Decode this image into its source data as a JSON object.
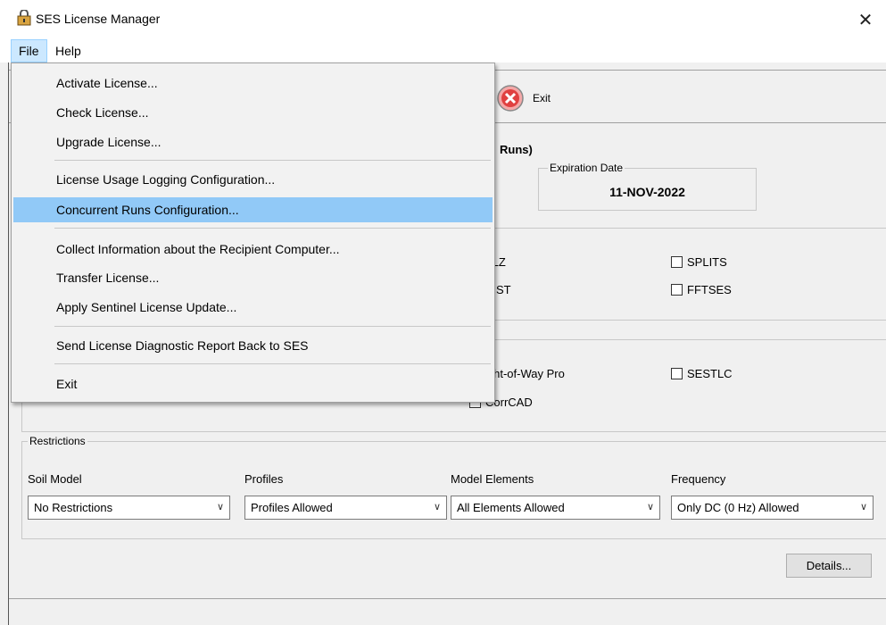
{
  "window": {
    "title": "SES License Manager",
    "close_glyph": "✕"
  },
  "menubar": {
    "file": "File",
    "help": "Help"
  },
  "toolbar": {
    "exit_label": "Exit"
  },
  "license": {
    "section_title_partial": "Runs)",
    "expiration_label": "Expiration Date",
    "expiration_value": "11-NOV-2022"
  },
  "modules_group1": [
    {
      "label": "ALZ",
      "checked": false
    },
    {
      "label": "SPLITS",
      "checked": false
    },
    {
      "label": "DIST",
      "checked": false
    },
    {
      "label": "FFTSES",
      "checked": false
    }
  ],
  "modules_group2": [
    {
      "label": "ight-of-Way Pro",
      "checked": false
    },
    {
      "label": "SESTLC",
      "checked": false
    },
    {
      "label": "CorrCAD",
      "checked": false
    }
  ],
  "restrictions": {
    "legend": "Restrictions",
    "fields": [
      {
        "label": "Soil Model",
        "value": "No Restrictions"
      },
      {
        "label": "Profiles",
        "value": "Profiles Allowed"
      },
      {
        "label": "Model Elements",
        "value": "All Elements Allowed"
      },
      {
        "label": "Frequency",
        "value": "Only DC (0 Hz) Allowed"
      }
    ]
  },
  "details_button": "Details...",
  "file_menu": {
    "items": [
      "Activate License...",
      "Check License...",
      "Upgrade License...",
      "License Usage Logging Configuration...",
      "Concurrent Runs Configuration...",
      "Collect Information about the Recipient Computer...",
      "Transfer License...",
      "Apply Sentinel License Update...",
      "Send License Diagnostic Report Back to SES",
      "Exit"
    ],
    "highlighted": "Concurrent Runs Configuration..."
  },
  "colors": {
    "highlight": "#91c9f7",
    "menu_active": "#cce8ff"
  }
}
